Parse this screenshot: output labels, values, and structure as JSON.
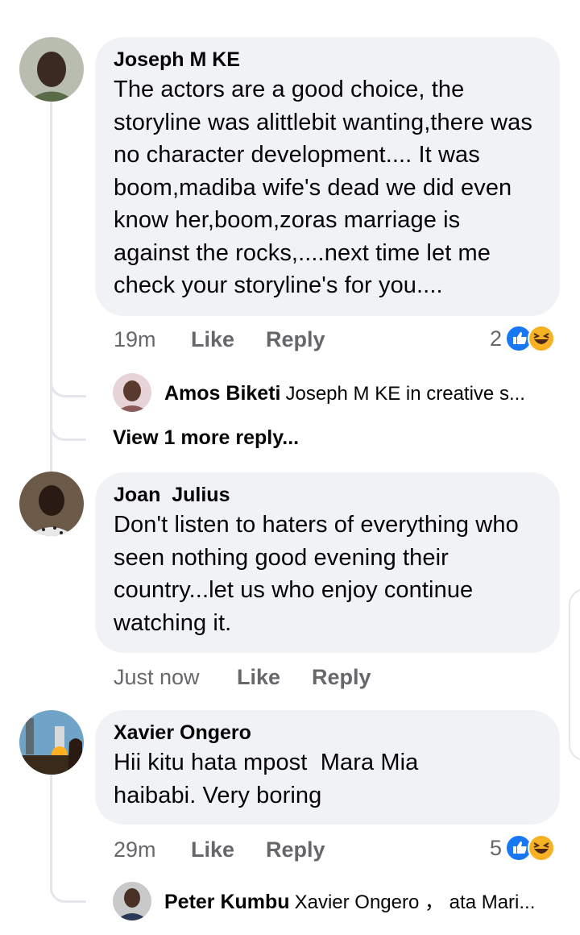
{
  "comments": [
    {
      "author": "Joseph M KE",
      "text": "The actors are a good choice, the storyline was alittlebit wanting,there was no character development.... It was boom,madiba wife's dead we did even know her,boom,zoras marriage is against the rocks,....next time let me check your storyline's for you....",
      "time": "19m",
      "like_label": "Like",
      "reply_label": "Reply",
      "reaction_count": "2",
      "reactions": [
        "like-icon",
        "haha-icon"
      ],
      "reply_preview": {
        "author": "Amos Biketi",
        "snippet": "Joseph M KE in creative s..."
      },
      "more_replies": "View 1 more reply..."
    },
    {
      "author": "Joan  Julius",
      "text": "Don't listen to haters of everything who seen nothing good evening their country...let us who enjoy continue watching it.",
      "time": "Just now",
      "like_label": "Like",
      "reply_label": "Reply"
    },
    {
      "author": "Xavier Ongero",
      "text": "Hii kitu hata mpost  Mara Mia haibabi. Very boring",
      "time": "29m",
      "like_label": "Like",
      "reply_label": "Reply",
      "reaction_count": "5",
      "reactions": [
        "like-icon",
        "haha-icon"
      ],
      "reply_preview": {
        "author": "Peter Kumbu",
        "snippet": "Xavier Ongero ， ata Mari..."
      }
    }
  ],
  "colors": {
    "bubble": "#f0f2f5",
    "meta": "#65676b",
    "like_blue": "#1877f2",
    "haha_yellow": "#f7b125",
    "thread": "#e4e6eb"
  }
}
